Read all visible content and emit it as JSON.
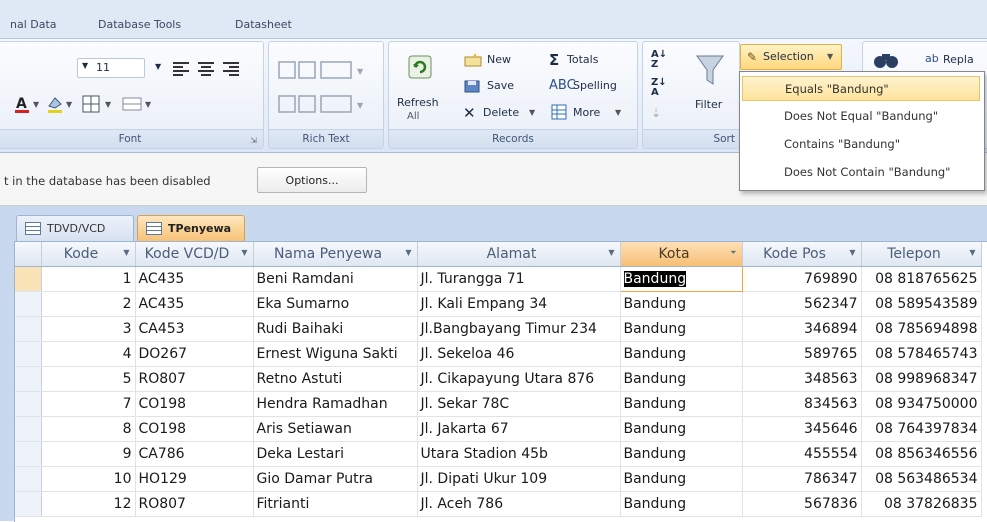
{
  "ribbon_tabs": [
    "nal Data",
    "Database Tools",
    "Datasheet"
  ],
  "font_group": {
    "label": "Font",
    "font_size": "11"
  },
  "rich_text_group": {
    "label": "Rich Text"
  },
  "records_group": {
    "label": "Records",
    "refresh_label": "Refresh",
    "refresh_sub": "All",
    "new_label": "New",
    "save_label": "Save",
    "delete_label": "Delete",
    "totals_label": "Totals",
    "spelling_label": "Spelling",
    "more_label": "More"
  },
  "sort_group": {
    "label": "Sort",
    "filter_label": "Filter",
    "selection_label": "Selection",
    "replace_label": "Repla"
  },
  "selection_menu": {
    "items": [
      "Equals \"Bandung\"",
      "Does Not Equal \"Bandung\"",
      "Contains \"Bandung\"",
      "Does Not Contain \"Bandung\""
    ],
    "hovered_index": 0
  },
  "message_bar": {
    "text": "t in the database has been disabled",
    "options_label": "Options..."
  },
  "doc_tabs": [
    {
      "label": "TDVD/VCD",
      "selected": false
    },
    {
      "label": "TPenyewa",
      "selected": true
    }
  ],
  "table": {
    "columns": [
      "Kode",
      "Kode VCD/D",
      "Nama Penyewa",
      "Alamat",
      "Kota",
      "Kode Pos",
      "Telepon"
    ],
    "rows": [
      [
        "1",
        "AC435",
        "Beni Ramdani",
        "Jl. Turangga 71",
        "Bandung",
        "769890",
        "08 818765625"
      ],
      [
        "2",
        "AC435",
        "Eka Sumarno",
        "Jl. Kali Empang 34",
        "Bandung",
        "562347",
        "08 589543589"
      ],
      [
        "3",
        "CA453",
        "Rudi Baihaki",
        "Jl.Bangbayang Timur 234",
        "Bandung",
        "346894",
        "08 785694898"
      ],
      [
        "4",
        "DO267",
        "Ernest Wiguna Sakti",
        "Jl. Sekeloa 46",
        "Bandung",
        "589765",
        "08 578465743"
      ],
      [
        "5",
        "RO807",
        "Retno Astuti",
        "Jl. Cikapayung Utara 876",
        "Bandung",
        "348563",
        "08 998968347"
      ],
      [
        "7",
        "CO198",
        "Hendra Ramadhan",
        "Jl. Sekar 78C",
        "Bandung",
        "834563",
        "08 934750000"
      ],
      [
        "8",
        "CO198",
        "Aris  Setiawan",
        "Jl. Jakarta 67",
        "Bandung",
        "345646",
        "08 764397834"
      ],
      [
        "9",
        "CA786",
        "Deka Lestari",
        "Utara Stadion 45b",
        "Bandung",
        "455554",
        "08 856346556"
      ],
      [
        "10",
        "HO129",
        "Gio Damar Putra",
        "Jl. Dipati Ukur 109",
        "Bandung",
        "786347",
        "08 563486534"
      ],
      [
        "12",
        "RO807",
        "Fitrianti",
        "Jl. Aceh 786",
        "Bandung",
        "567836",
        "08  37826835"
      ]
    ],
    "active_row": 0,
    "active_value": "Bandung"
  },
  "colors": {
    "accent": "#f7bf74",
    "ribbon_bg": "#dfe8f5",
    "highlight": "#fde39a"
  }
}
